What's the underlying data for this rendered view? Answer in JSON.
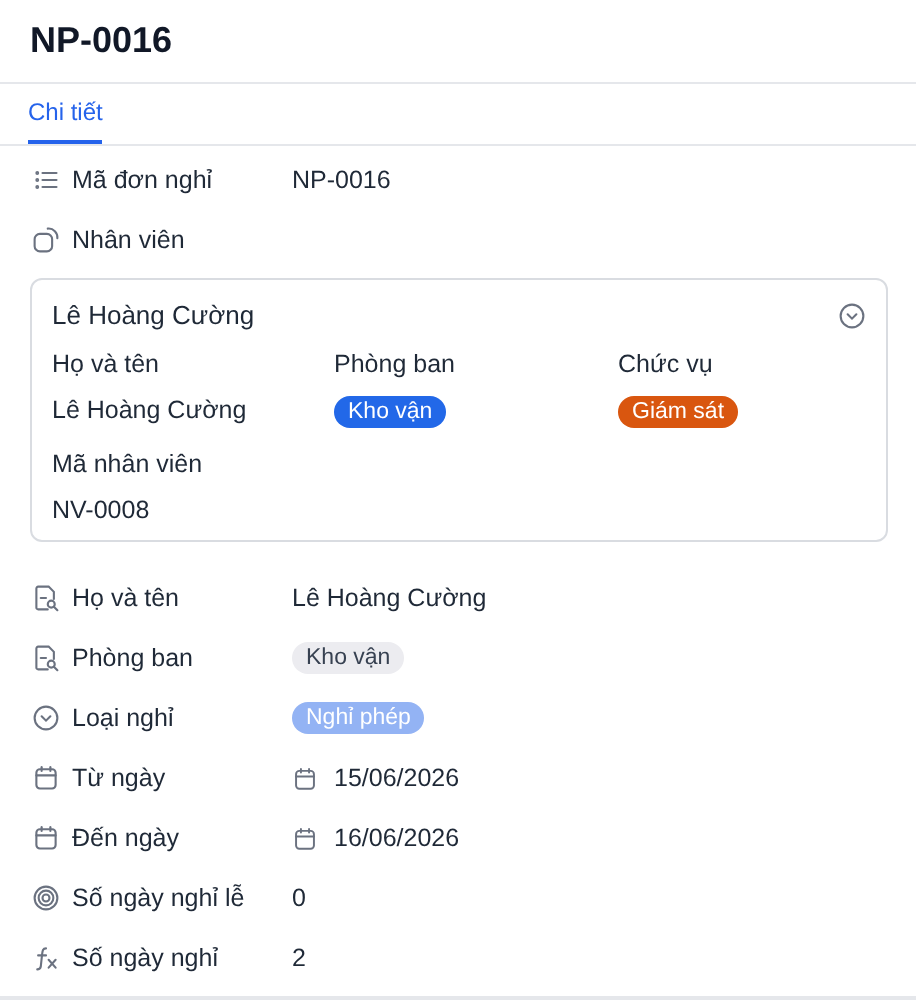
{
  "title": "NP-0016",
  "tabs": [
    {
      "label": "Chi tiết",
      "selected": true
    }
  ],
  "fields_top": [
    {
      "kind": "autonumber",
      "label": "Mã đơn nghỉ",
      "value": "NP-0016"
    },
    {
      "kind": "link",
      "label": "Nhân viên"
    }
  ],
  "employee_card": {
    "title": "Lê Hoàng Cường",
    "expanded": true,
    "fields": [
      {
        "label": "Họ và tên",
        "value": "Lê Hoàng Cường"
      },
      {
        "label": "Phòng ban",
        "value": "Kho vận",
        "color": "#2268e8"
      },
      {
        "label": "Chức vụ",
        "value": "Giám sát",
        "color": "#d9560f"
      },
      {
        "label": "Mã nhân viên",
        "value": "NV-0008"
      }
    ]
  },
  "fields": [
    {
      "kind": "lookup",
      "label": "Họ và tên",
      "value": "Lê Hoàng Cường"
    },
    {
      "kind": "lookup",
      "label": "Phòng ban",
      "value": "Kho vận",
      "color": "#ececf0"
    },
    {
      "kind": "select",
      "label": "Loại nghỉ",
      "value": "Nghỉ phép",
      "color": "#93b3f4"
    },
    {
      "kind": "date",
      "label": "Từ ngày",
      "value": "15/06/2026"
    },
    {
      "kind": "date",
      "label": "Đến ngày",
      "value": "16/06/2026"
    },
    {
      "kind": "rollup",
      "label": "Số ngày nghỉ lễ",
      "value": "0"
    },
    {
      "kind": "formula",
      "label": "Số ngày nghỉ",
      "value": "2"
    }
  ]
}
